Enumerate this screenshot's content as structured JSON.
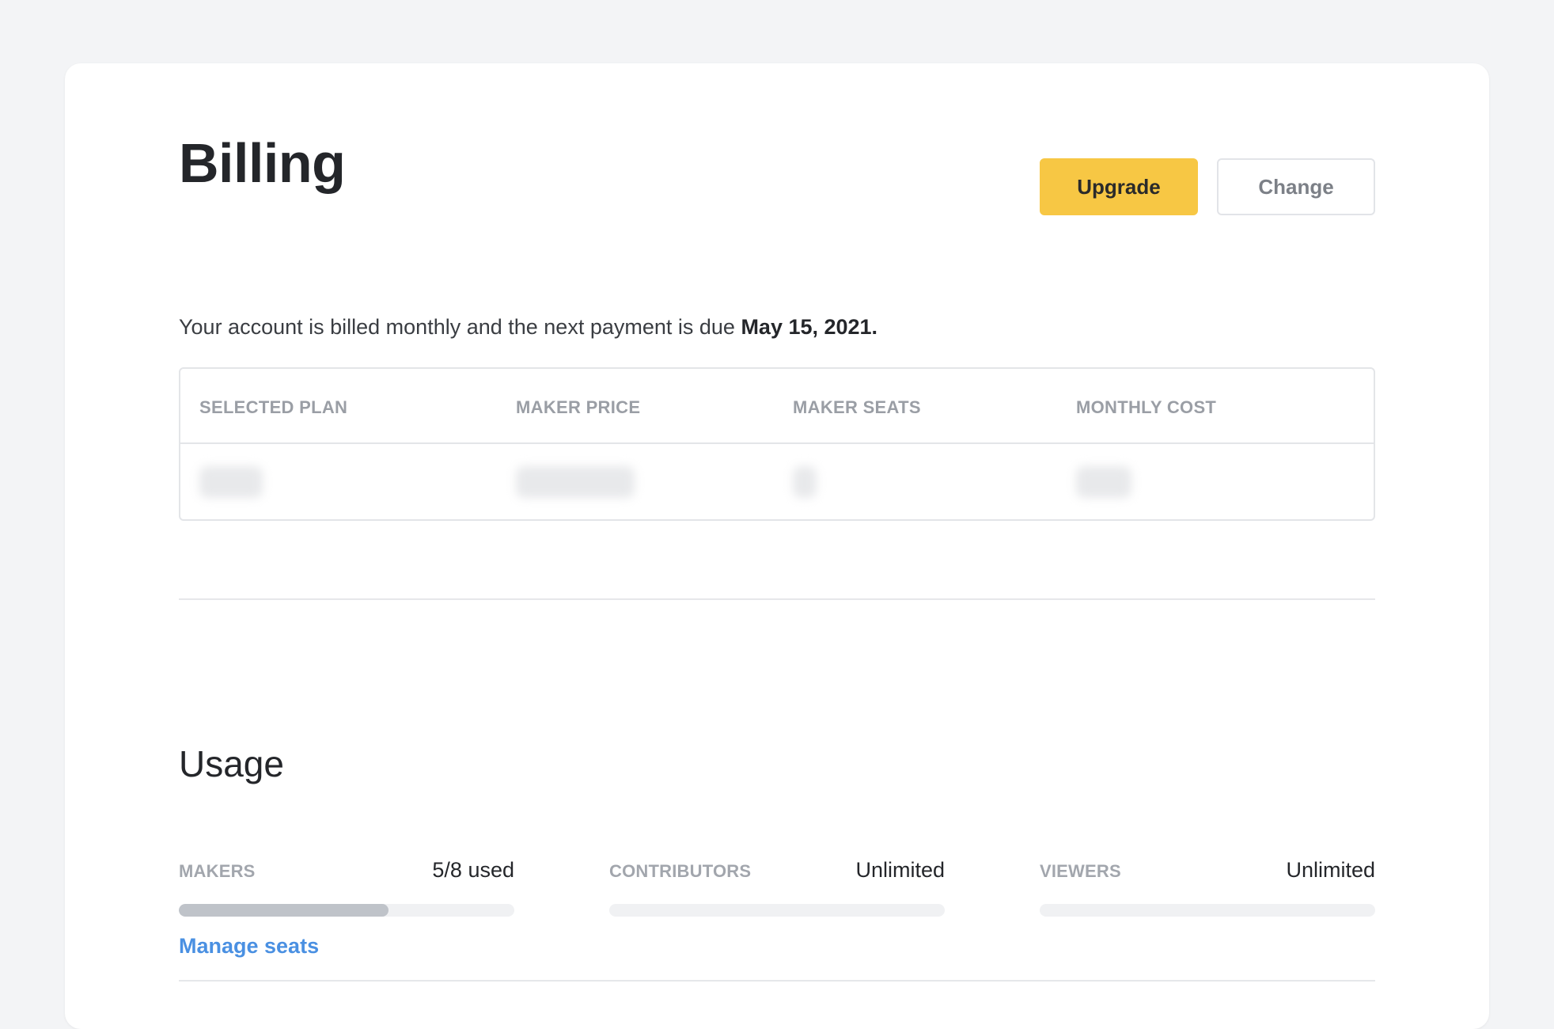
{
  "billing": {
    "title": "Billing",
    "upgrade_label": "Upgrade",
    "change_label": "Change",
    "note_prefix": "Your account is billed monthly and the next payment is due ",
    "due_date": "May 15, 2021."
  },
  "plan_table": {
    "headers": [
      "SELECTED PLAN",
      "MAKER PRICE",
      "MAKER SEATS",
      "MONTHLY COST"
    ],
    "row_redacted": true
  },
  "usage": {
    "title": "Usage",
    "meters": [
      {
        "label": "MAKERS",
        "value": "5/8 used",
        "fill_fraction": 0.625
      },
      {
        "label": "CONTRIBUTORS",
        "value": "Unlimited",
        "fill_fraction": 0
      },
      {
        "label": "VIEWERS",
        "value": "Unlimited",
        "fill_fraction": 0
      }
    ],
    "manage_label": "Manage seats"
  },
  "colors": {
    "upgrade_button": "#f7c744",
    "link": "#4a90e2",
    "meter_fill": "#bfc3c9",
    "page_background": "#f3f4f6"
  }
}
